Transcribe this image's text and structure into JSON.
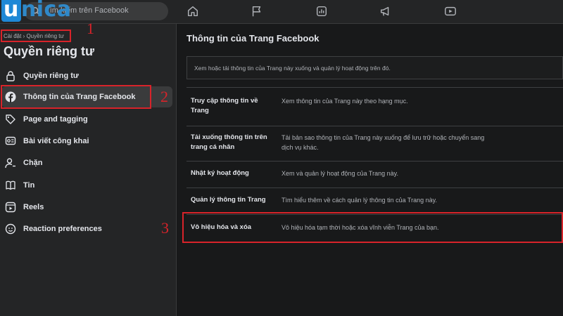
{
  "logo": {
    "text_u": "u",
    "text_rest": "nica"
  },
  "search": {
    "placeholder": "Tìm kiếm trên Facebook"
  },
  "nav": [
    "home-icon",
    "flag-icon",
    "chart-icon",
    "megaphone-icon",
    "video-icon"
  ],
  "sidebar": {
    "breadcrumb": "Cài đặt › Quyền riêng tư",
    "title": "Quyền riêng tư",
    "items": [
      {
        "label": "Quyền riêng tư",
        "icon": "lock-icon"
      },
      {
        "label": "Thông tin của Trang Facebook",
        "icon": "facebook-icon"
      },
      {
        "label": "Page and tagging",
        "icon": "tag-icon"
      },
      {
        "label": "Bài viết công khai",
        "icon": "public-post-icon"
      },
      {
        "label": "Chặn",
        "icon": "block-user-icon"
      },
      {
        "label": "Tin",
        "icon": "book-icon"
      },
      {
        "label": "Reels",
        "icon": "reels-icon"
      },
      {
        "label": "Reaction preferences",
        "icon": "reaction-icon"
      }
    ]
  },
  "annotations": {
    "n1": "1",
    "n2": "2",
    "n3": "3"
  },
  "main": {
    "title": "Thông tin của Trang Facebook",
    "description": "Xem hoặc tải thông tin của Trang này xuống và quản lý hoạt động trên đó.",
    "rows": [
      {
        "key": "Truy cập thông tin về Trang",
        "value": "Xem thông tin của Trang này theo hạng mục."
      },
      {
        "key": "Tải xuống thông tin trên trang cá nhân",
        "value": "Tải bản sao thông tin của Trang này xuống để lưu trữ hoặc chuyển sang dịch vụ khác."
      },
      {
        "key": "Nhật ký hoạt động",
        "value": "Xem và quản lý hoạt động của Trang này."
      },
      {
        "key": "Quản lý thông tin Trang",
        "value": "Tìm hiểu thêm về cách quản lý thông tin của Trang này."
      },
      {
        "key": "Vô hiệu hóa và xóa",
        "value": "Vô hiệu hóa tạm thời hoặc xóa vĩnh viễn Trang của bạn."
      }
    ]
  },
  "colors": {
    "annotation_red": "#d8232a",
    "brand_blue": "#1e88d6"
  }
}
